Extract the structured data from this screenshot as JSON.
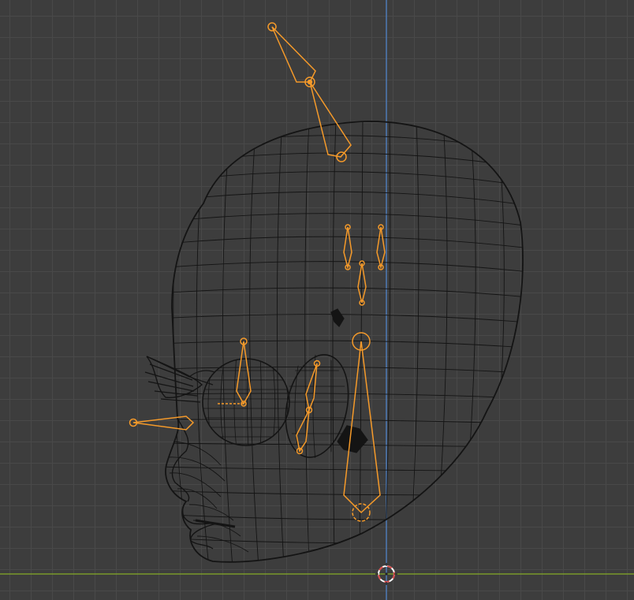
{
  "viewport": {
    "view": "side-orthographic",
    "grid": true,
    "colors": {
      "background": "#3d3d3d",
      "grid_line": "#494949",
      "axis_z": "#4f7fbf",
      "axis_y": "#7a9a2a",
      "mesh_wire": "#141414",
      "bone_selected": "#f59a2a",
      "cursor_red": "#d94b4b",
      "cursor_white": "#ffffff"
    }
  },
  "objects": {
    "mesh": {
      "name_icon": "mesh-icon",
      "display": "wireframe"
    },
    "armature": {
      "name_icon": "armature-icon",
      "display": "octahedral",
      "state": "selected"
    }
  },
  "cursor": {
    "icon": "3d-cursor-icon"
  }
}
